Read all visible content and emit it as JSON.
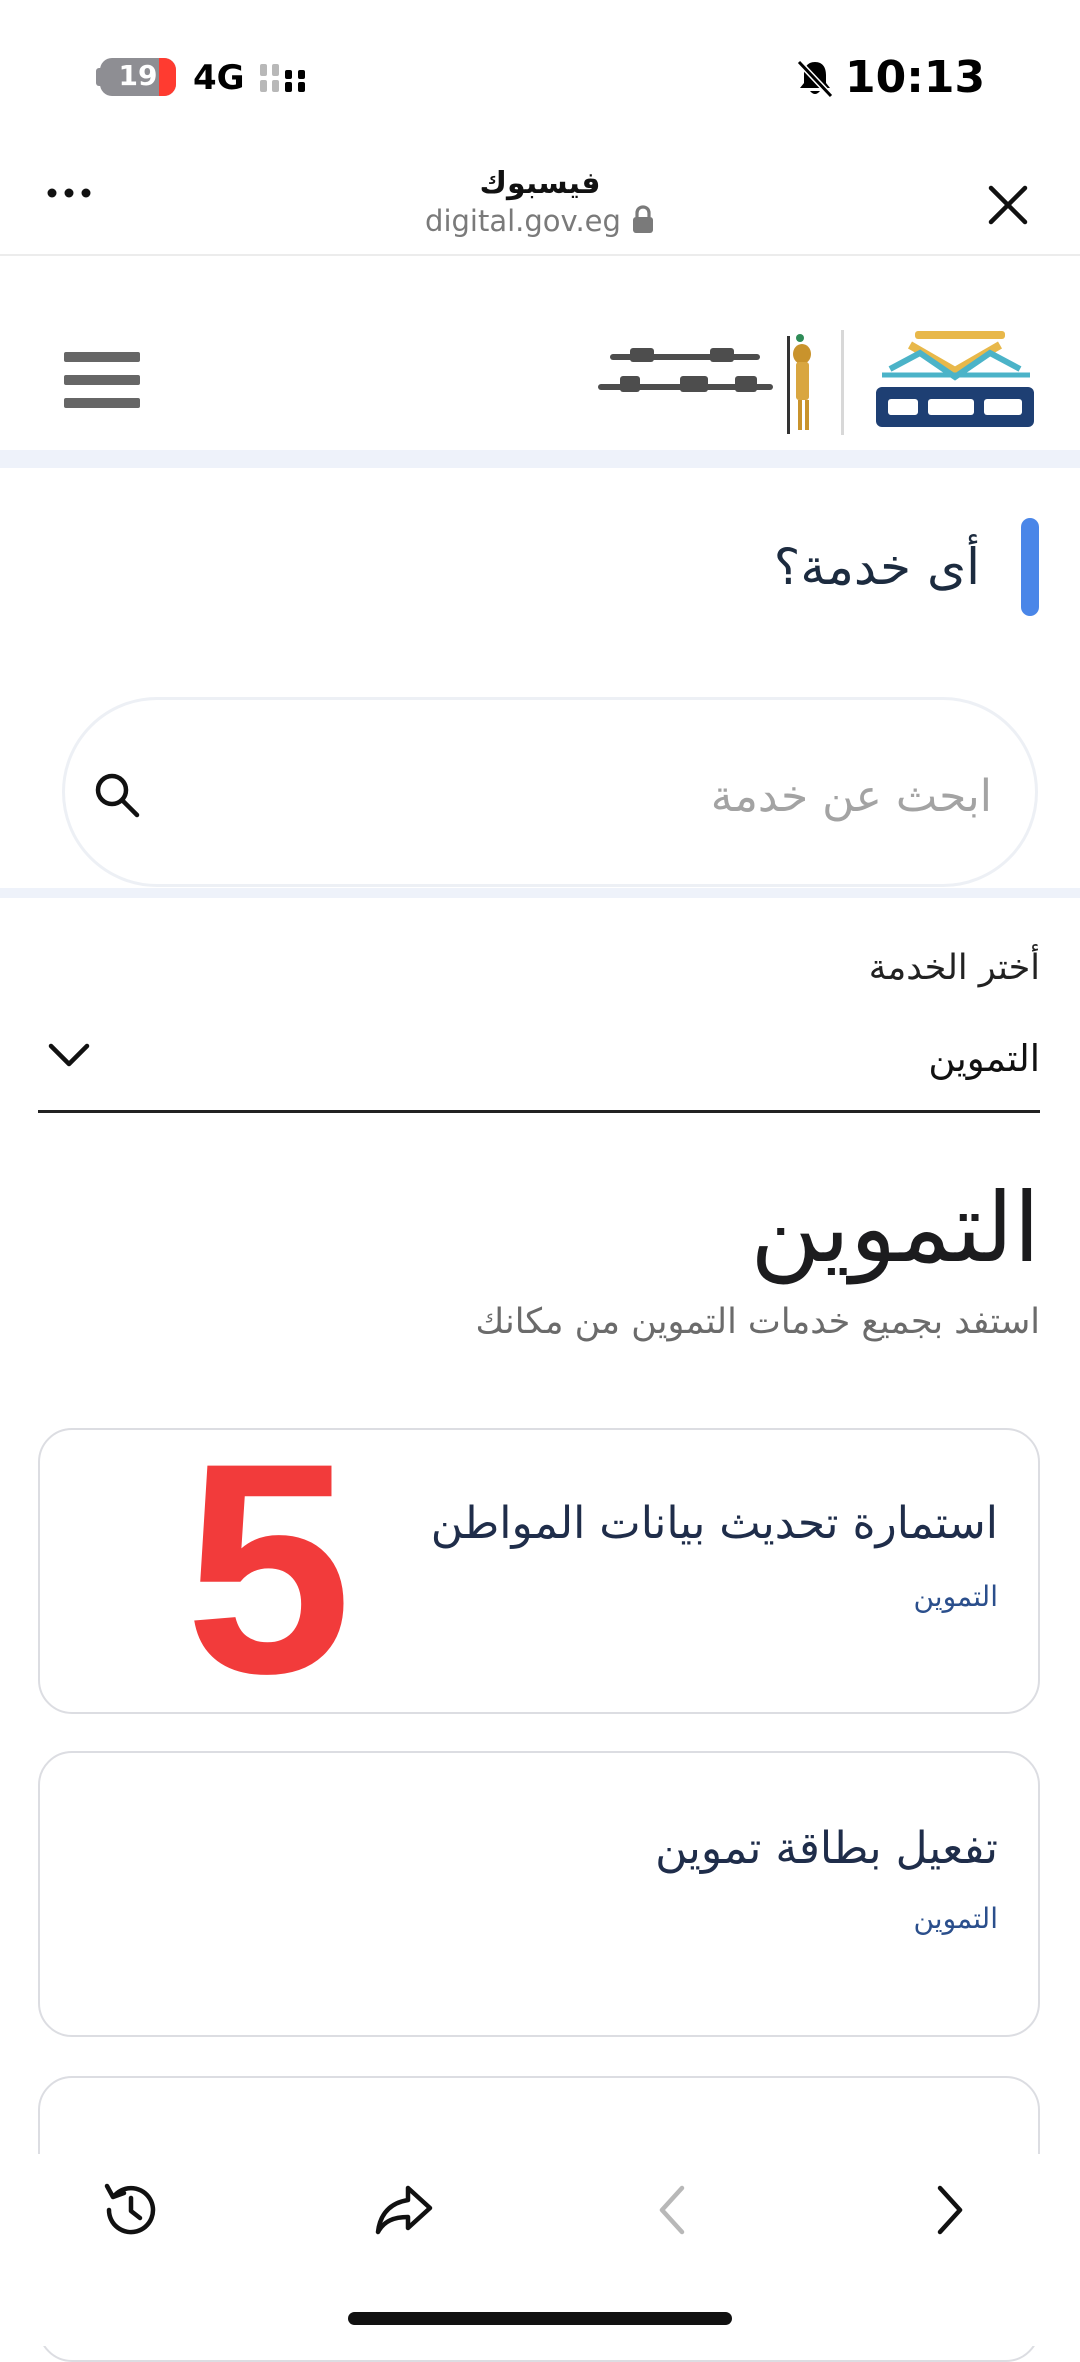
{
  "status_bar": {
    "time": "10:13",
    "battery_level": "19",
    "network": "4G",
    "icons": [
      "battery-icon",
      "signal-icon",
      "mute-bell-icon"
    ]
  },
  "browser": {
    "tab_title": "فيسبوك",
    "url": "digital.gov.eg",
    "icons": [
      "more-icon",
      "lock-icon",
      "close-icon"
    ]
  },
  "header": {
    "icons": [
      "menu-icon",
      "digital-egypt-logo",
      "ministry-logo"
    ]
  },
  "service_finder": {
    "question": "أى خدمة؟",
    "search_placeholder": "ابحث عن خدمة"
  },
  "service_select": {
    "label": "أختر الخدمة",
    "selected": "التموين"
  },
  "category": {
    "title": "التموين",
    "subtitle": "استفد بجميع خدمات التموين من مكانك"
  },
  "cards": [
    {
      "title": "استمارة تحديث بيانات المواطن",
      "tag": "التموين"
    },
    {
      "title": "تفعيل بطاقة تموين",
      "tag": "التموين"
    }
  ],
  "overlay_number": "5",
  "toolbar": {
    "icons": [
      "history-icon",
      "share-icon",
      "back-arrow-icon",
      "forward-arrow-icon"
    ]
  },
  "colors": {
    "accent": "#4a86e8",
    "overlay_red": "#f23b3b",
    "card_title": "#1f2d4a"
  }
}
